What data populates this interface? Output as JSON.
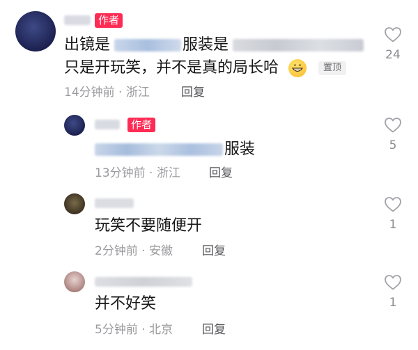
{
  "comments": [
    {
      "author_tag": "作者",
      "text_prefix": "出镜是",
      "text_mid": "服装是",
      "text_line2": "只是开玩笑，并不是真的局长哈",
      "emoji": "grinning-face-emoji",
      "pin_label": "置顶",
      "time_location": "14分钟前 · 浙江",
      "reply_label": "回复",
      "likes": "24"
    },
    {
      "author_tag": "作者",
      "text_suffix": "服装",
      "time_location": "13分钟前 · 浙江",
      "reply_label": "回复",
      "likes": "5"
    },
    {
      "text": "玩笑不要随便开",
      "time_location": "2分钟前 · 安徽",
      "reply_label": "回复",
      "likes": "1"
    },
    {
      "text": "并不好笑",
      "time_location": "5分钟前 · 北京",
      "reply_label": "回复",
      "likes": "1"
    }
  ],
  "colors": {
    "author_tag_bg": "#fe2c55",
    "meta_text": "#9a9a9e",
    "reply_text": "#555559"
  }
}
